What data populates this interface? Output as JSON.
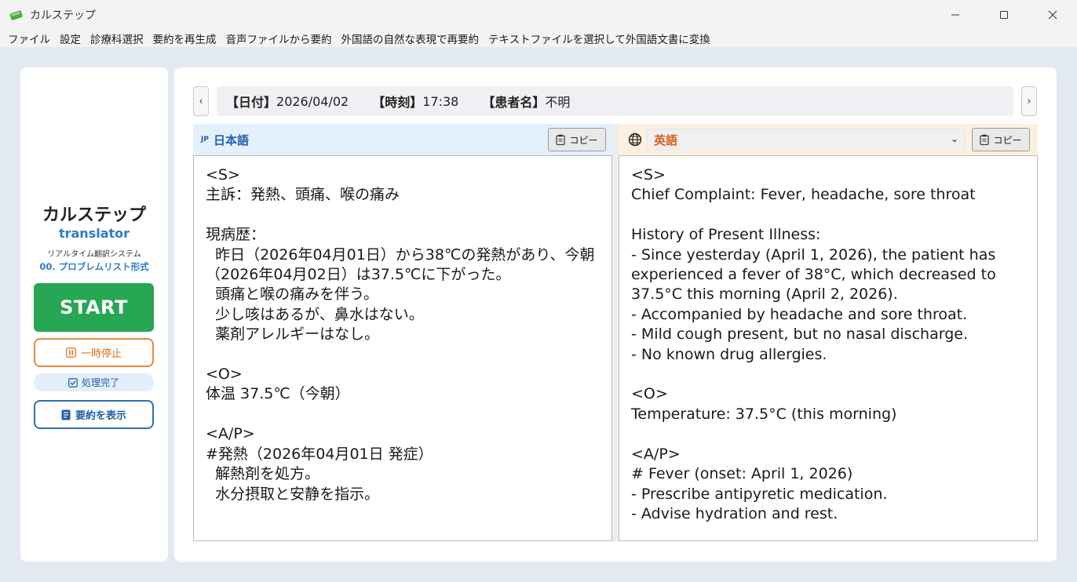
{
  "window": {
    "title": "カルステップ"
  },
  "menu": [
    "ファイル",
    "設定",
    "診療科選択",
    "要約を再生成",
    "音声ファイルから要約",
    "外国語の自然な表現で再要約",
    "テキストファイルを選択して外国語文書に変換"
  ],
  "sidebar": {
    "app_name": "カルステップ",
    "app_sub": "translator",
    "description": "リアルタイム翻訳システム",
    "mode": "00. プロブレムリスト形式",
    "start_label": "START",
    "pause_label": "一時停止",
    "status_label": "処理完了",
    "summary_label": "要約を表示"
  },
  "info": {
    "date_label": "【日付】",
    "date": "2026/04/02",
    "time_label": "【時刻】",
    "time": "17:38",
    "patient_label": "【患者名】",
    "patient": "不明"
  },
  "nav": {
    "prev": "‹",
    "next": "›"
  },
  "jp_pane": {
    "tag": "JP",
    "lang": "日本語",
    "copy_label": "コピー",
    "text": "<S>\n主訴：発熱、頭痛、喉の痛み\n\n現病歴：\n  昨日（2026年04月01日）から38℃の発熱があり、今朝\n（2026年04月02日）は37.5℃に下がった。\n  頭痛と喉の痛みを伴う。\n  少し咳はあるが、鼻水はない。\n  薬剤アレルギーはなし。\n\n<O>\n体温 37.5℃（今朝）\n\n<A/P>\n#発熱（2026年04月01日 発症）\n  解熱剤を処方。\n  水分摂取と安静を指示。"
  },
  "en_pane": {
    "lang": "英語",
    "copy_label": "コピー",
    "text": "<S>\nChief Complaint: Fever, headache, sore throat\n\nHistory of Present Illness:\n- Since yesterday (April 1, 2026), the patient has\nexperienced a fever of 38°C, which decreased to\n37.5°C this morning (April 2, 2026).\n- Accompanied by headache and sore throat.\n- Mild cough present, but no nasal discharge.\n- No known drug allergies.\n\n<O>\nTemperature: 37.5°C (this morning)\n\n<A/P>\n# Fever (onset: April 1, 2026)\n- Prescribe antipyretic medication.\n- Advise hydration and rest."
  }
}
